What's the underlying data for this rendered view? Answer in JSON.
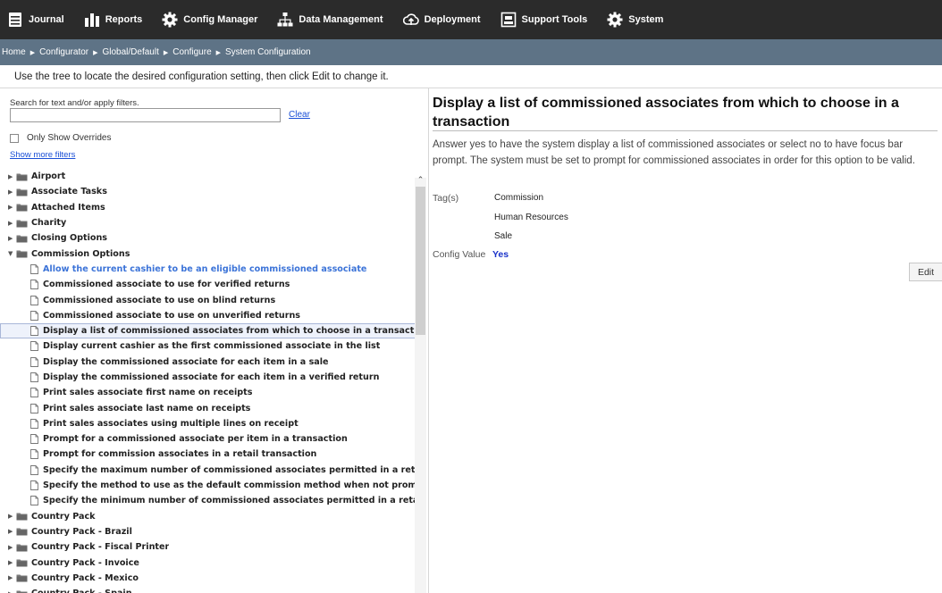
{
  "nav": {
    "items": [
      {
        "label": "Journal",
        "icon": "journal-icon"
      },
      {
        "label": "Reports",
        "icon": "bar-chart-icon"
      },
      {
        "label": "Config Manager",
        "icon": "gear-icon"
      },
      {
        "label": "Data Management",
        "icon": "hierarchy-icon"
      },
      {
        "label": "Deployment",
        "icon": "cloud-upload-icon"
      },
      {
        "label": "Support Tools",
        "icon": "toolbox-icon"
      },
      {
        "label": "System",
        "icon": "gear-icon"
      }
    ]
  },
  "breadcrumb": [
    "Home",
    "Configurator",
    "Global/Default",
    "Configure",
    "System Configuration"
  ],
  "instructions": "Use the tree to locate the desired configuration setting, then click Edit to change it.",
  "search": {
    "label": "Search for text and/or apply filters.",
    "value": "",
    "clear_label": "Clear",
    "override_label": "Only Show Overrides",
    "override_checked": false,
    "more_filters_label": "Show more filters"
  },
  "tree": {
    "categories_before": [
      "Airport",
      "Associate Tasks",
      "Attached Items",
      "Charity",
      "Closing Options"
    ],
    "expanded": {
      "label": "Commission Options",
      "items": [
        "Allow the current cashier to be an eligible commissioned associate",
        "Commissioned associate to use for verified returns",
        "Commissioned associate to use on blind returns",
        "Commissioned associate to use on unverified returns",
        "Display a list of commissioned associates from which to choose in a transaction",
        "Display current cashier as the first commissioned associate in the list",
        "Display the commissioned associate for each item in a sale",
        "Display the commissioned associate for each item in a verified return",
        "Print sales associate first name on receipts",
        "Print sales associate last name on receipts",
        "Print sales associates using multiple lines on receipt",
        "Prompt for a commissioned associate per item in a transaction",
        "Prompt for commission associates in a retail transaction",
        "Specify the maximum number of commissioned associates permitted in a retail t",
        "Specify the method to use as the default commission method when not promptin",
        "Specify the minimum number of commissioned associates permitted in a retail tr"
      ],
      "selected_index": 4,
      "highlighted_index": 0
    },
    "categories_after": [
      "Country Pack",
      "Country Pack - Brazil",
      "Country Pack - Fiscal Printer",
      "Country Pack - Invoice",
      "Country Pack - Mexico",
      "Country Pack - Spain"
    ]
  },
  "detail": {
    "title": "Display a list of commissioned associates from which to choose in a transaction",
    "description": "Answer yes to have the system display a list of commissioned associates or select no to have focus bar prompt. The system must be set to prompt for commissioned associates in order for this option to be valid.",
    "tags_label": "Tag(s)",
    "tags": [
      "Commission",
      "Human Resources",
      "Sale"
    ],
    "config_value_label": "Config Value",
    "config_value": "Yes",
    "edit_label": "Edit"
  },
  "colors": {
    "topbar": "#2b2b2b",
    "breadcrumb_bar": "#5e7386",
    "link": "#1a4fd6",
    "highlight_text": "#3b73d8",
    "config_value": "#1a33c9"
  }
}
